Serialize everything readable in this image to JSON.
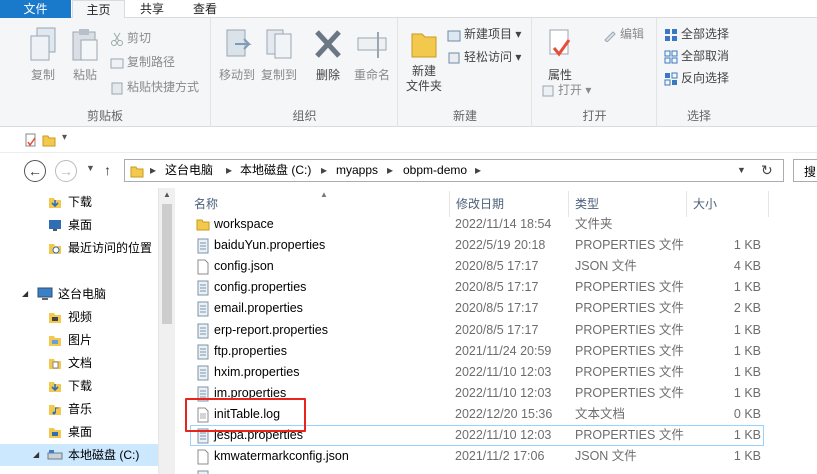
{
  "ribbon": {
    "tabs": [
      {
        "label": "文件"
      },
      {
        "label": "主页"
      },
      {
        "label": "共享"
      },
      {
        "label": "查看"
      }
    ],
    "clipboard": {
      "copy": "复制",
      "paste": "粘贴",
      "cut": "剪切",
      "copy_path": "复制路径",
      "paste_shortcut": "粘贴快捷方式",
      "group": "剪贴板"
    },
    "organize": {
      "move_to": "移动到",
      "copy_to": "复制到",
      "delete": "删除",
      "rename": "重命名",
      "group": "组织"
    },
    "new": {
      "new_folder": "新建\n文件夹",
      "new_item": "新建项目",
      "easy_access": "轻松访问",
      "group": "新建"
    },
    "open": {
      "properties": "属性",
      "open": "打开",
      "edit": "编辑",
      "group": "打开"
    },
    "select": {
      "select_all": "全部选择",
      "select_none": "全部取消",
      "invert": "反向选择",
      "group": "选择"
    }
  },
  "address": {
    "crumbs": [
      {
        "label": "这台电脑"
      },
      {
        "label": "本地磁盘 (C:)"
      },
      {
        "label": "myapps"
      },
      {
        "label": "obpm-demo"
      }
    ],
    "search_placeholder": "搜"
  },
  "nav": {
    "items": [
      {
        "label": "下载",
        "icon": "download-icon"
      },
      {
        "label": "桌面",
        "icon": "desktop-icon"
      },
      {
        "label": "最近访问的位置",
        "icon": "recent-icon"
      },
      {
        "label": "这台电脑",
        "icon": "computer-icon"
      },
      {
        "label": "视频",
        "icon": "video-icon"
      },
      {
        "label": "图片",
        "icon": "pictures-icon"
      },
      {
        "label": "文档",
        "icon": "documents-icon"
      },
      {
        "label": "下载",
        "icon": "download-icon"
      },
      {
        "label": "音乐",
        "icon": "music-icon"
      },
      {
        "label": "桌面",
        "icon": "desktop-icon"
      },
      {
        "label": "本地磁盘 (C:)",
        "icon": "drive-icon"
      }
    ]
  },
  "files": {
    "columns": [
      {
        "label": "名称"
      },
      {
        "label": "修改日期"
      },
      {
        "label": "类型"
      },
      {
        "label": "大小"
      }
    ],
    "rows": [
      {
        "name": "workspace",
        "date": "2022/11/14 18:54",
        "type": "文件夹",
        "size": "",
        "icon": "folder-icon"
      },
      {
        "name": "baiduYun.properties",
        "date": "2022/5/19 20:18",
        "type": "PROPERTIES 文件",
        "size": "1 KB",
        "icon": "properties-file-icon"
      },
      {
        "name": "config.json",
        "date": "2020/8/5 17:17",
        "type": "JSON 文件",
        "size": "4 KB",
        "icon": "file-icon"
      },
      {
        "name": "config.properties",
        "date": "2020/8/5 17:17",
        "type": "PROPERTIES 文件",
        "size": "1 KB",
        "icon": "properties-file-icon"
      },
      {
        "name": "email.properties",
        "date": "2020/8/5 17:17",
        "type": "PROPERTIES 文件",
        "size": "2 KB",
        "icon": "properties-file-icon"
      },
      {
        "name": "erp-report.properties",
        "date": "2020/8/5 17:17",
        "type": "PROPERTIES 文件",
        "size": "1 KB",
        "icon": "properties-file-icon"
      },
      {
        "name": "ftp.properties",
        "date": "2021/11/24 20:59",
        "type": "PROPERTIES 文件",
        "size": "1 KB",
        "icon": "properties-file-icon"
      },
      {
        "name": "hxim.properties",
        "date": "2022/11/10 12:03",
        "type": "PROPERTIES 文件",
        "size": "1 KB",
        "icon": "properties-file-icon"
      },
      {
        "name": "im.properties",
        "date": "2022/11/10 12:03",
        "type": "PROPERTIES 文件",
        "size": "1 KB",
        "icon": "properties-file-icon"
      },
      {
        "name": "initTable.log",
        "date": "2022/12/20 15:36",
        "type": "文本文档",
        "size": "0 KB",
        "icon": "text-file-icon"
      },
      {
        "name": "jespa.properties",
        "date": "2022/11/10 12:03",
        "type": "PROPERTIES 文件",
        "size": "1 KB",
        "icon": "properties-file-icon"
      },
      {
        "name": "kmwatermarkconfig.json",
        "date": "2021/11/2 17:06",
        "type": "JSON 文件",
        "size": "1 KB",
        "icon": "file-icon"
      },
      {
        "name": "",
        "date": "",
        "type": "",
        "size": "",
        "icon": "properties-file-icon"
      }
    ]
  },
  "colors": {
    "accent": "#1979ca",
    "highlight": "#e8241c",
    "selection": "#99d1ff",
    "header_text": "#4c607a"
  }
}
